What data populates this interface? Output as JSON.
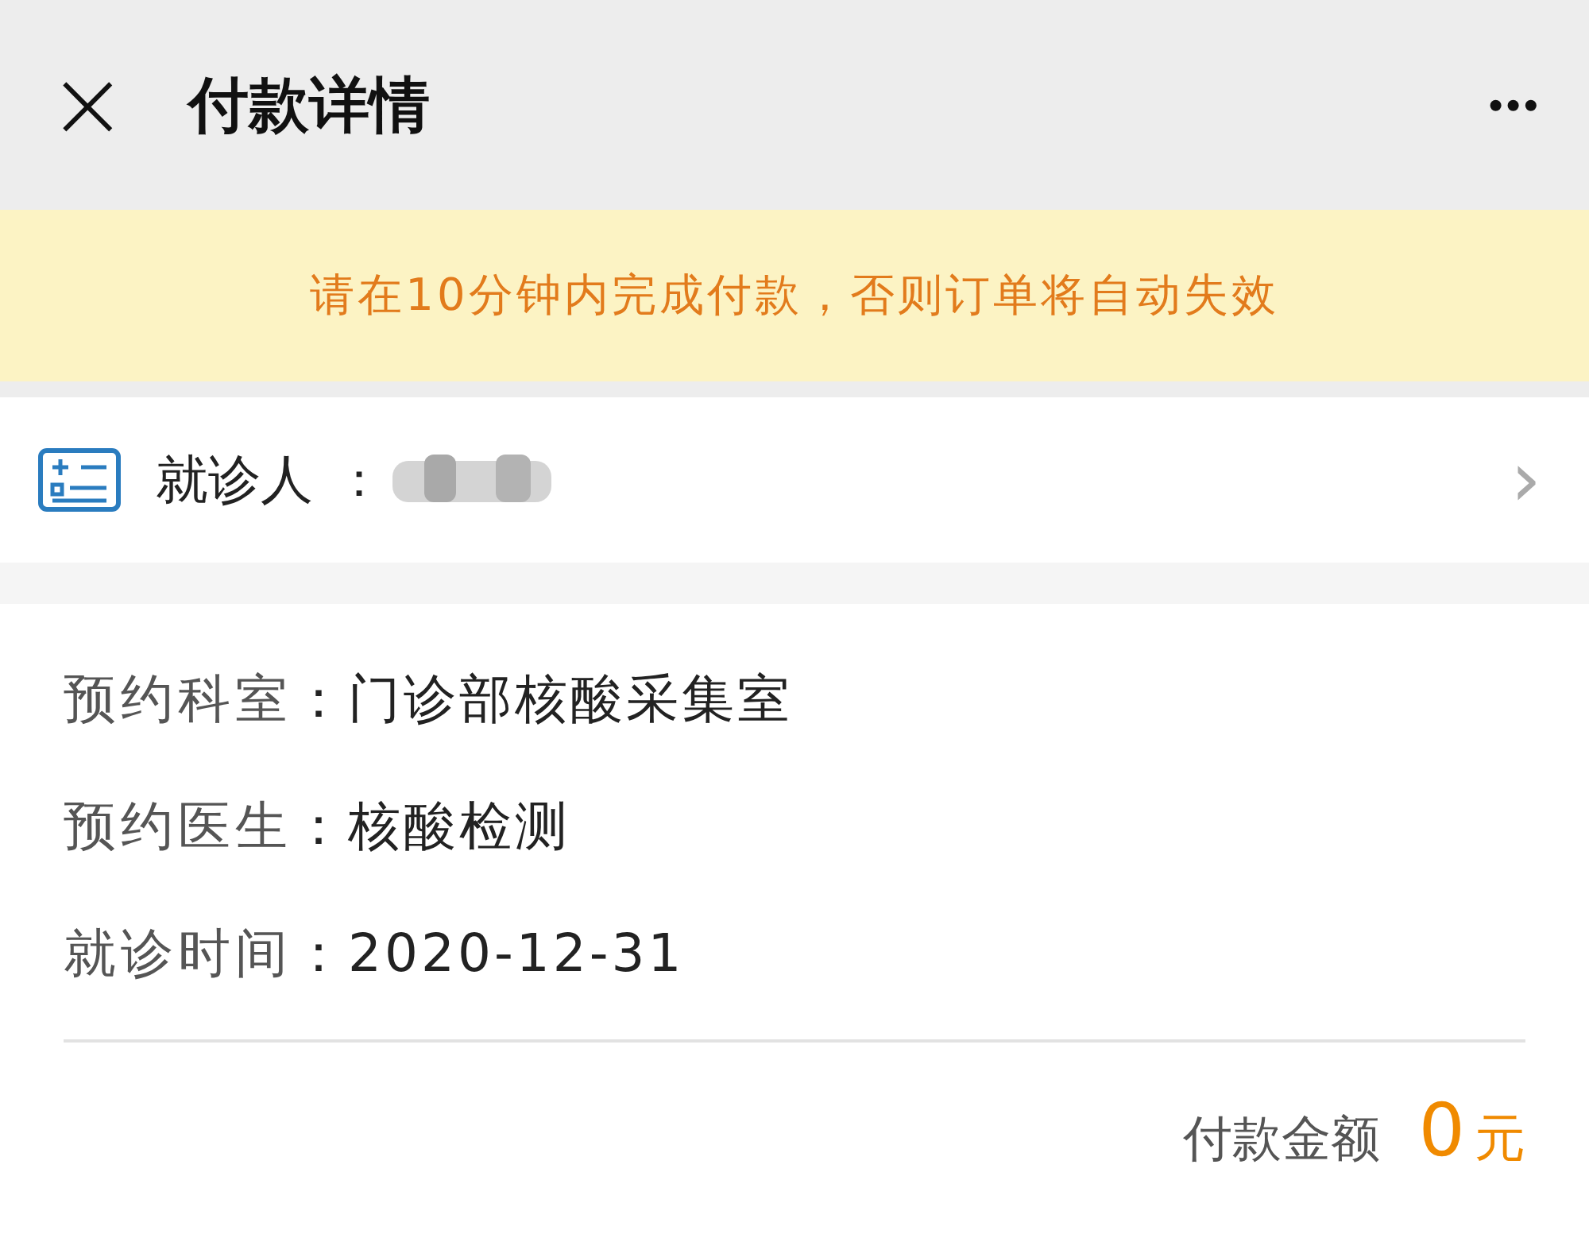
{
  "header": {
    "close": "×",
    "title": "付款详情",
    "more": "•••"
  },
  "notice": "请在10分钟内完成付款，否则订单将自动失效",
  "patient": {
    "label": "就诊人",
    "colon": "：",
    "name_blurred": true,
    "chevron": "›"
  },
  "details": [
    {
      "label": "预约科室",
      "value": "：门诊部核酸采集室"
    },
    {
      "label": "预约医生",
      "value": "：核酸检测"
    },
    {
      "label": "就诊时间",
      "value": "：2020-12-31"
    }
  ],
  "amount": {
    "label": "付款金额",
    "value": "0",
    "unit": "元"
  }
}
